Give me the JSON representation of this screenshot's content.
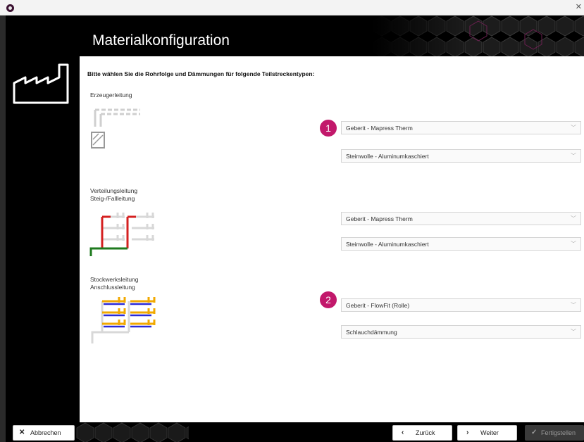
{
  "window": {
    "close_glyph": "✕"
  },
  "header": {
    "title": "Materialkonfiguration"
  },
  "instruction": "Bitte wählen Sie die Rohrfolge und Dämmungen für folgende Teilstreckentypen:",
  "sections": [
    {
      "label_lines": [
        "Erzeugerleitung"
      ],
      "pipe": "Geberit - Mapress Therm",
      "insulation": "Steinwolle - Aluminumkaschiert",
      "badge": "1"
    },
    {
      "label_lines": [
        "Verteilungsleitung",
        "Steig-/Fallleitung"
      ],
      "pipe": "Geberit - Mapress Therm",
      "insulation": "Steinwolle - Aluminumkaschiert"
    },
    {
      "label_lines": [
        "Stockwerksleitung",
        "Anschlussleitung"
      ],
      "pipe": "Geberit - FlowFit (Rolle)",
      "insulation": "Schlauchdämmung",
      "badge": "2"
    }
  ],
  "footer": {
    "cancel": "Abbrechen",
    "back": "Zurück",
    "next": "Weiter",
    "finish": "Fertigstellen"
  },
  "icons": [
    "app-icon",
    "factory-icon",
    "chevron-down-icon",
    "close-icon",
    "chevron-left-icon",
    "chevron-right-icon",
    "check-icon"
  ],
  "colors": {
    "accent_badge": "#c2186b",
    "pipe_red": "#d42020",
    "pipe_green": "#1e7a1e",
    "pipe_yellow": "#f2a900",
    "pipe_blue": "#2a2ad8"
  }
}
